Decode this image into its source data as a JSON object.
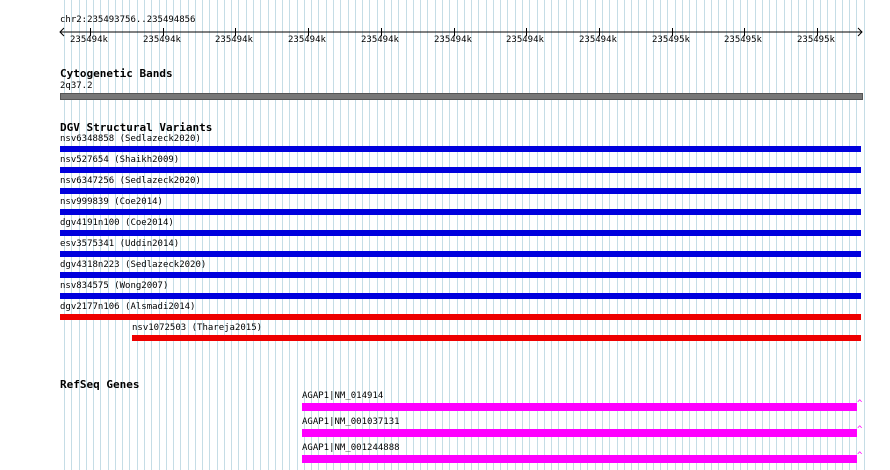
{
  "ruler": {
    "region": "chr2:235493756..235494856",
    "ticks": [
      "235494k",
      "235494k",
      "235494k",
      "235494k",
      "235494k",
      "235494k",
      "235494k",
      "235494k",
      "235495k",
      "235495k",
      "235495k"
    ]
  },
  "tracks": {
    "cytoband": {
      "title": "Cytogenetic Bands",
      "band": "2q37.2",
      "color": "#777777"
    },
    "dgv": {
      "title": "DGV Structural Variants",
      "items": [
        {
          "label": "nsv6348858 (Sedlazeck2020)",
          "color": "#0000dd",
          "start": 0.0,
          "end": 1.0
        },
        {
          "label": "nsv527654 (Shaikh2009)",
          "color": "#0000dd",
          "start": 0.0,
          "end": 1.0
        },
        {
          "label": "nsv6347256 (Sedlazeck2020)",
          "color": "#0000dd",
          "start": 0.0,
          "end": 1.0
        },
        {
          "label": "nsv999839 (Coe2014)",
          "color": "#0000dd",
          "start": 0.0,
          "end": 1.0
        },
        {
          "label": "dgv4191n100 (Coe2014)",
          "color": "#0000dd",
          "start": 0.0,
          "end": 1.0
        },
        {
          "label": "esv3575341 (Uddin2014)",
          "color": "#0000dd",
          "start": 0.0,
          "end": 1.0
        },
        {
          "label": "dgv4318n223 (Sedlazeck2020)",
          "color": "#0000dd",
          "start": 0.0,
          "end": 1.0
        },
        {
          "label": "nsv834575 (Wong2007)",
          "color": "#0000dd",
          "start": 0.0,
          "end": 1.0
        },
        {
          "label": "dgv2177n106 (Alsmadi2014)",
          "color": "#ee0000",
          "start": 0.0,
          "end": 1.0
        },
        {
          "label": "nsv1072503 (Thareja2015)",
          "color": "#ee0000",
          "start": 0.09,
          "end": 1.0
        }
      ]
    },
    "refseq": {
      "title": "RefSeq Genes",
      "items": [
        {
          "label": "AGAP1|NM_014914",
          "color": "#ff00ff",
          "start": 0.302,
          "end": 0.995
        },
        {
          "label": "AGAP1|NM_001037131",
          "color": "#ff00ff",
          "start": 0.302,
          "end": 0.995
        },
        {
          "label": "AGAP1|NM_001244888",
          "color": "#ff00ff",
          "start": 0.302,
          "end": 0.995
        }
      ]
    }
  }
}
